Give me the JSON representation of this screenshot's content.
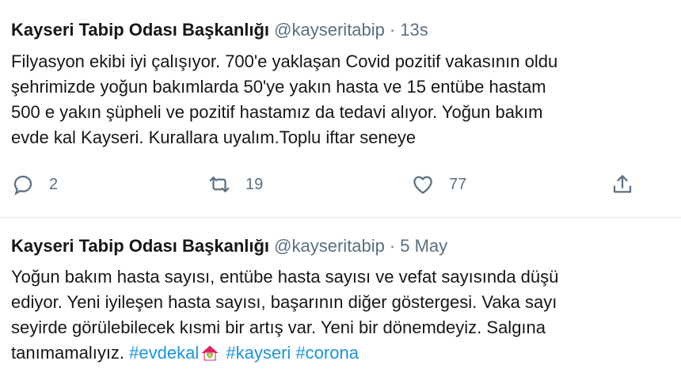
{
  "tweets": [
    {
      "author": "Kayseri Tabip Odası Başkanlığı",
      "handle": "@kayseritabip",
      "separator": "·",
      "time": "13s",
      "lines": [
        "Filyasyon ekibi iyi çalışıyor. 700'e yaklaşan Covid pozitif vakasının oldu",
        "şehrimizde yoğun bakımlarda 50'ye yakın hasta ve 15 entübe hastam",
        "500 e yakın şüpheli ve pozitif hastamız da tedavi alıyor. Yoğun bakım",
        "evde kal Kayseri. Kurallara uyalım.Toplu iftar seneye"
      ],
      "actions": {
        "reply_count": "2",
        "retweet_count": "19",
        "like_count": "77",
        "reply_icon": "reply-icon",
        "retweet_icon": "retweet-icon",
        "like_icon": "heart-icon",
        "share_icon": "share-icon"
      }
    },
    {
      "author": "Kayseri Tabip Odası Başkanlığı",
      "handle": "@kayseritabip",
      "separator": "·",
      "time": "5 May",
      "lines": [
        "Yoğun bakım hasta sayısı, entübe hasta sayısı ve vefat sayısında düşü",
        "ediyor. Yeni iyileşen hasta sayısı, başarının diğer göstergesi. Vaka sayı",
        "seyirde görülebilecek kısmi bir artış var. Yeni bir dönemdeyiz. Salgına"
      ],
      "last_line_text": "tanımamalıyız.",
      "hashtags": [
        "#evdekal",
        "#kayseri",
        "#corona"
      ],
      "emoji": "house-with-heart-emoji"
    }
  ],
  "colors": {
    "text": "#14171a",
    "muted": "#5b7083",
    "hashtag": "#1b95e0",
    "divider": "#e6ecf0",
    "emoji_house": "#e0245e"
  }
}
